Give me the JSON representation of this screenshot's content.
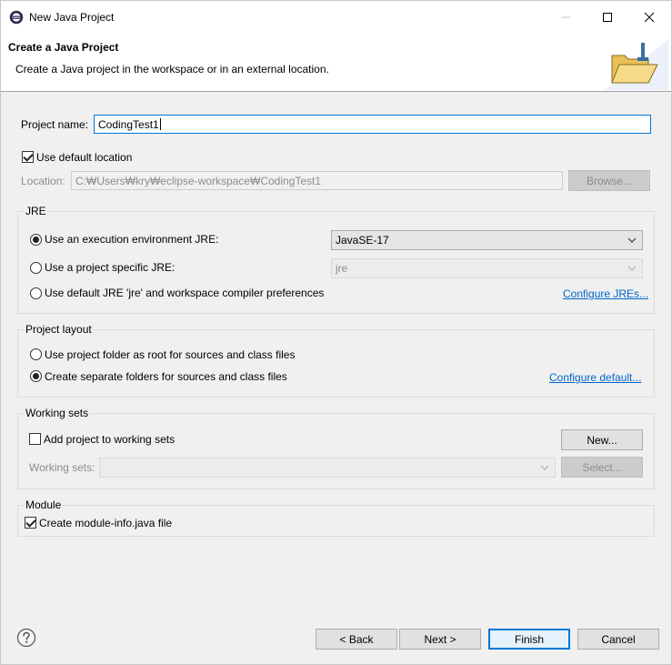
{
  "window": {
    "title": "New Java Project"
  },
  "banner": {
    "title": "Create a Java Project",
    "description": "Create a Java project in the workspace or in an external location."
  },
  "project": {
    "name_label": "Project name:",
    "name_value": "CodingTest1",
    "use_default_location_label": "Use default location",
    "use_default_location_checked": true,
    "location_label": "Location:",
    "location_value": "C:₩Users₩kry₩eclipse-workspace₩CodingTest1",
    "browse_label": "Browse..."
  },
  "jre": {
    "group_label": "JRE",
    "options": [
      {
        "label": "Use an execution environment JRE:",
        "selected": true
      },
      {
        "label": "Use a project specific JRE:",
        "selected": false
      },
      {
        "label": "Use default JRE 'jre' and workspace compiler preferences",
        "selected": false
      }
    ],
    "execution_env_value": "JavaSE-17",
    "project_jre_value": "jre",
    "configure_link": "Configure JREs..."
  },
  "layout": {
    "group_label": "Project layout",
    "options": [
      {
        "label": "Use project folder as root for sources and class files",
        "selected": false
      },
      {
        "label": "Create separate folders for sources and class files",
        "selected": true
      }
    ],
    "configure_link": "Configure default..."
  },
  "working_sets": {
    "group_label": "Working sets",
    "add_label": "Add project to working sets",
    "add_checked": false,
    "new_button": "New...",
    "sets_label": "Working sets:",
    "sets_value": "",
    "select_button": "Select..."
  },
  "module": {
    "group_label": "Module",
    "create_label": "Create module-info.java file",
    "create_checked": true
  },
  "footer": {
    "back": "< Back",
    "next": "Next >",
    "finish": "Finish",
    "cancel": "Cancel"
  },
  "colors": {
    "accent": "#0078d7",
    "link": "#0066cc"
  }
}
